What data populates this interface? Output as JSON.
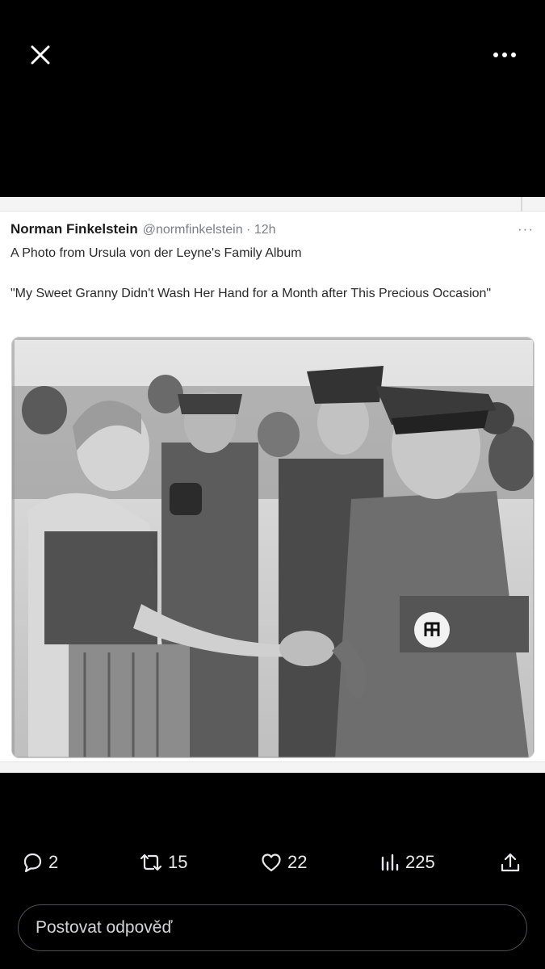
{
  "topbar": {
    "close_icon": "close-icon",
    "more_icon": "more-dots-icon"
  },
  "tweet": {
    "author_name": "Norman Finkelstein",
    "handle_time": "@normfinkelstein · 12h",
    "more": "···",
    "line1": "A Photo from Ursula von der Leyne's Family Album",
    "line2": "\"My Sweet Granny Didn't Wash Her Hand for a Month after This Precious Occasion\""
  },
  "actions": {
    "replies": "2",
    "reposts": "15",
    "likes": "22",
    "views": "225"
  },
  "reply": {
    "placeholder": "Postovat odpověď"
  },
  "colors": {
    "background": "#000000",
    "text_light": "#e7e9ea",
    "border": "#4d5156"
  }
}
